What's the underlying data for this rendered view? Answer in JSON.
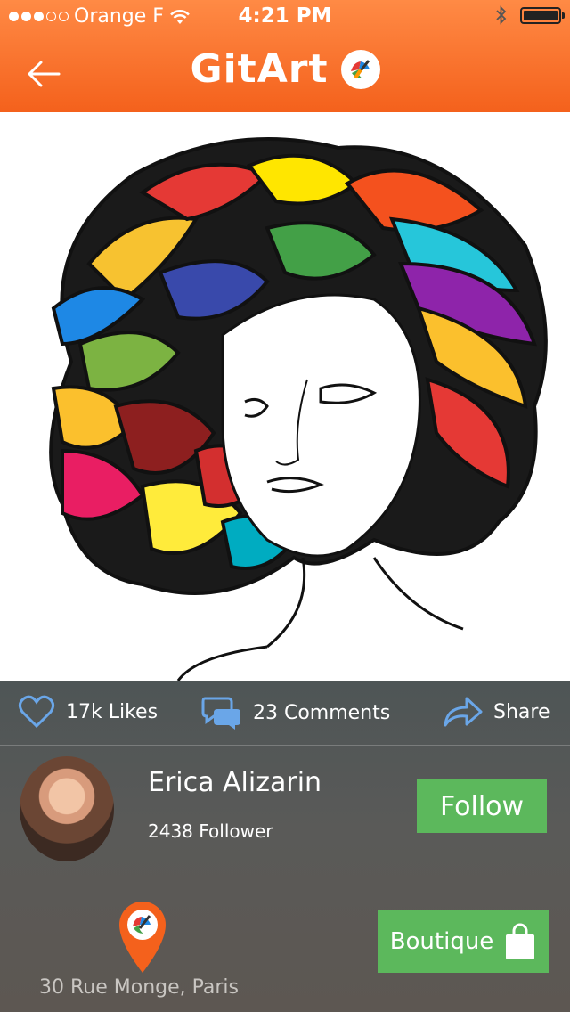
{
  "status_bar": {
    "carrier": "Orange F",
    "time": "4:21 PM",
    "signal_bars_filled": 3,
    "signal_bars_total": 5,
    "battery_level": 1.0
  },
  "nav": {
    "title": "GitArt",
    "back_icon": "arrow-left-icon",
    "logo_icon": "paintbrush-logo-icon"
  },
  "artwork": {
    "subject": "colorful-hair-portrait-illustration"
  },
  "actions": {
    "likes_label": "17k Likes",
    "comments_label": "23 Comments",
    "share_label": "Share"
  },
  "user": {
    "name": "Erica Alizarin",
    "followers": "2438 Follower",
    "follow_label": "Follow"
  },
  "location": {
    "address": "30 Rue Monge, Paris"
  },
  "shop": {
    "label": "Boutique"
  },
  "colors": {
    "header_orange": "#f4611c",
    "button_green": "#5cb85c",
    "icon_blue": "#6aa6e8"
  }
}
